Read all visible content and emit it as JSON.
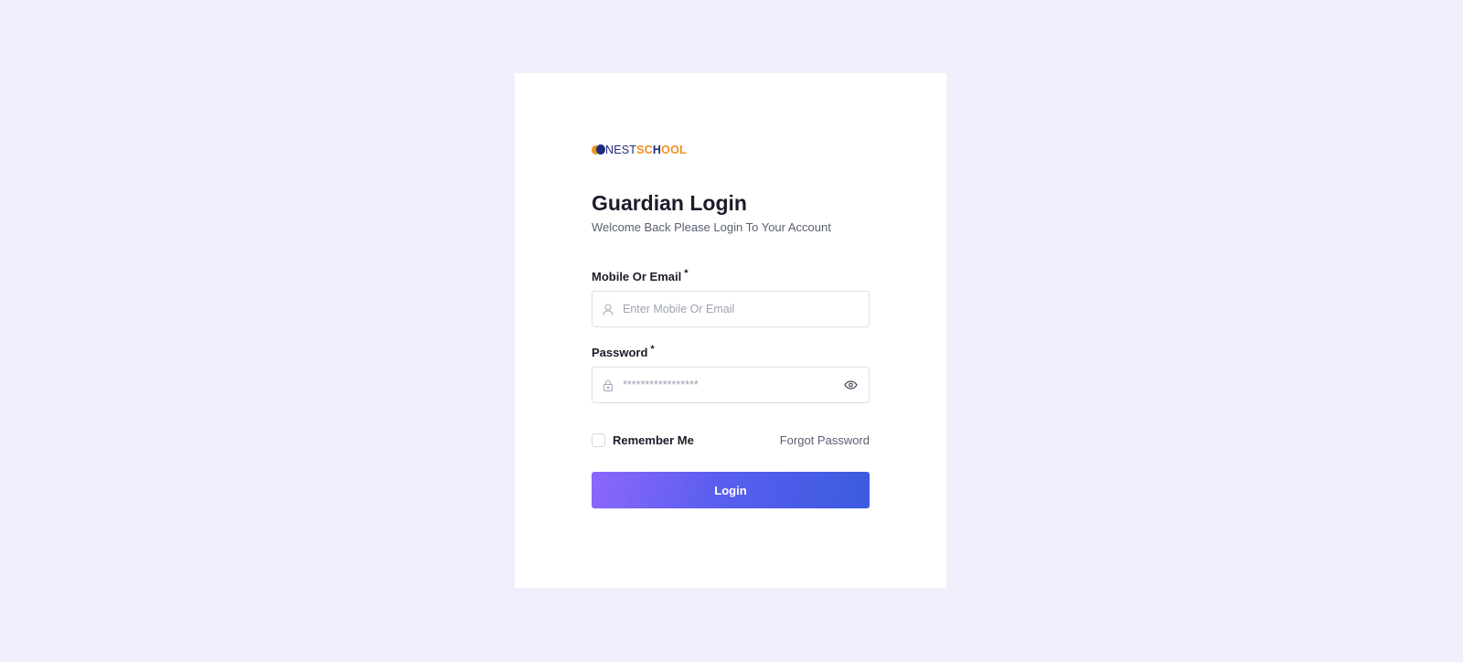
{
  "brand": {
    "logo_text_part1": "NEST",
    "logo_text_part2_a": "SC",
    "logo_text_part2_b": "H",
    "logo_text_part2_c": "OOL",
    "colors": {
      "navy": "#1F2C7C",
      "orange": "#F0901F"
    }
  },
  "login": {
    "title": "Guardian Login",
    "subtitle": "Welcome Back Please Login To Your Account",
    "email_label": "Mobile Or Email",
    "email_required_mark": "*",
    "email_placeholder": "Enter Mobile Or Email",
    "email_icon": "user-icon",
    "password_label": "Password",
    "password_required_mark": "*",
    "password_placeholder": "*****************",
    "password_icon": "lock-icon",
    "password_toggle_icon": "eye-icon",
    "remember_label": "Remember Me",
    "remember_checked": false,
    "forgot_label": "Forgot Password",
    "submit_label": "Login"
  },
  "theme": {
    "page_background": "#EFF0FB",
    "button_gradient_start": "#8B68FB",
    "button_gradient_end": "#3B5BDF"
  }
}
